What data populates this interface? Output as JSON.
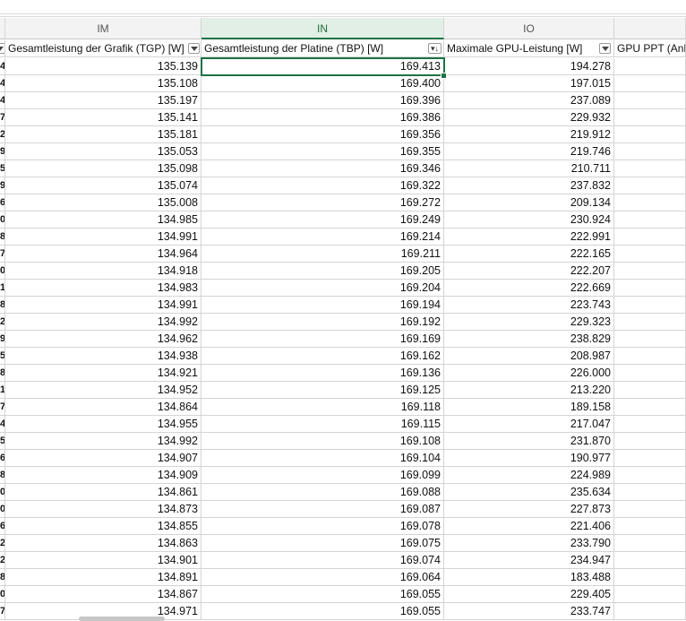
{
  "columns": [
    {
      "letter": "IM",
      "header": "Gesamtleistung der Grafik (TGP) [W]"
    },
    {
      "letter": "IN",
      "header": "Gesamtleistung der Platine (TBP) [W]"
    },
    {
      "letter": "IO",
      "header": "Maximale GPU-Leistung [W]"
    },
    {
      "letter": "",
      "header": "GPU PPT (Anha"
    }
  ],
  "active_column": "IN",
  "left_edge_digits": [
    "4",
    "4",
    "4",
    "7",
    "2",
    "9",
    "5",
    "9",
    "6",
    "0",
    "8",
    "7",
    "0",
    "1",
    "8",
    "2",
    "9",
    "5",
    "8",
    "1",
    "7",
    "4",
    "5",
    "6",
    "8",
    "0",
    "0",
    "6",
    "2",
    "2",
    "8",
    "0",
    "7"
  ],
  "rows": [
    [
      "135.139",
      "169.413",
      "194.278"
    ],
    [
      "135.108",
      "169.400",
      "197.015"
    ],
    [
      "135.197",
      "169.396",
      "237.089"
    ],
    [
      "135.141",
      "169.386",
      "229.932"
    ],
    [
      "135.181",
      "169.356",
      "219.912"
    ],
    [
      "135.053",
      "169.355",
      "219.746"
    ],
    [
      "135.098",
      "169.346",
      "210.711"
    ],
    [
      "135.074",
      "169.322",
      "237.832"
    ],
    [
      "135.008",
      "169.272",
      "209.134"
    ],
    [
      "134.985",
      "169.249",
      "230.924"
    ],
    [
      "134.991",
      "169.214",
      "222.991"
    ],
    [
      "134.964",
      "169.211",
      "222.165"
    ],
    [
      "134.918",
      "169.205",
      "222.207"
    ],
    [
      "134.983",
      "169.204",
      "222.669"
    ],
    [
      "134.991",
      "169.194",
      "223.743"
    ],
    [
      "134.992",
      "169.192",
      "229.323"
    ],
    [
      "134.962",
      "169.169",
      "238.829"
    ],
    [
      "134.938",
      "169.162",
      "208.987"
    ],
    [
      "134.921",
      "169.136",
      "226.000"
    ],
    [
      "134.952",
      "169.125",
      "213.220"
    ],
    [
      "134.864",
      "169.118",
      "189.158"
    ],
    [
      "134.955",
      "169.115",
      "217.047"
    ],
    [
      "134.992",
      "169.108",
      "231.870"
    ],
    [
      "134.907",
      "169.104",
      "190.977"
    ],
    [
      "134.909",
      "169.099",
      "224.989"
    ],
    [
      "134.861",
      "169.088",
      "235.634"
    ],
    [
      "134.873",
      "169.087",
      "227.873"
    ],
    [
      "134.855",
      "169.078",
      "221.406"
    ],
    [
      "134.863",
      "169.075",
      "233.790"
    ],
    [
      "134.901",
      "169.074",
      "234.947"
    ],
    [
      "134.891",
      "169.064",
      "183.488"
    ],
    [
      "134.867",
      "169.055",
      "229.405"
    ],
    [
      "134.971",
      "169.055",
      "233.747"
    ]
  ],
  "colors": {
    "accent": "#1e7145",
    "active_header_bg": "#e2efe6"
  },
  "icons": [
    "filter-dropdown-icon",
    "sort-filter-icon"
  ]
}
